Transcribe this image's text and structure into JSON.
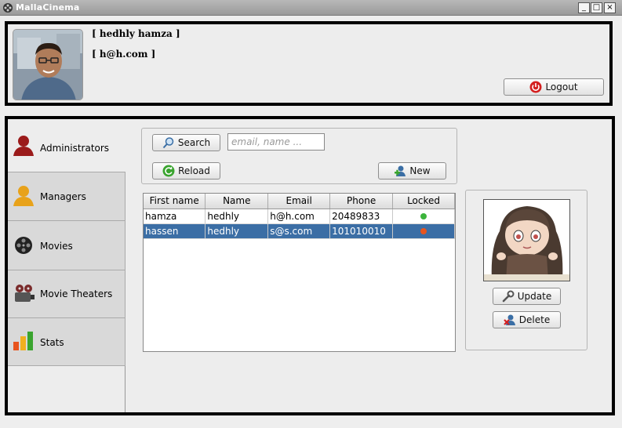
{
  "window": {
    "title": "MallaCinema",
    "min": "_",
    "max": "□",
    "close": "×"
  },
  "header": {
    "user_name": "[ hedhly hamza ]",
    "user_email": "[ h@h.com ]",
    "logout_label": "Logout",
    "logout_icon": "power-icon"
  },
  "sidebar": {
    "items": [
      {
        "label": "Administrators",
        "icon": "admin-user-icon",
        "color": "#9b1b1b"
      },
      {
        "label": "Managers",
        "icon": "manager-user-icon",
        "color": "#e8a21a"
      },
      {
        "label": "Movies",
        "icon": "film-reel-icon",
        "color": "#222222"
      },
      {
        "label": "Movie Theaters",
        "icon": "projector-icon",
        "color": "#7a2b2b"
      },
      {
        "label": "Stats",
        "icon": "bar-chart-icon",
        "color": "#3aa42f"
      }
    ]
  },
  "search": {
    "button_label": "Search",
    "placeholder": "email, name ...",
    "reload_label": "Reload",
    "new_label": "New"
  },
  "table": {
    "columns": [
      "First name",
      "Name",
      "Email",
      "Phone",
      "Locked"
    ],
    "rows": [
      {
        "first_name": "hamza",
        "name": "hedhly",
        "email": "h@h.com",
        "phone": "20489833",
        "locked": false
      },
      {
        "first_name": "hassen",
        "name": "hedhly",
        "email": "s@s.com",
        "phone": "101010010",
        "locked": true
      }
    ],
    "unlocked_color": "#3cb43c",
    "locked_color": "#e8541e",
    "selected_color": "#3b6ea5"
  },
  "detail": {
    "update_label": "Update",
    "delete_label": "Delete"
  }
}
